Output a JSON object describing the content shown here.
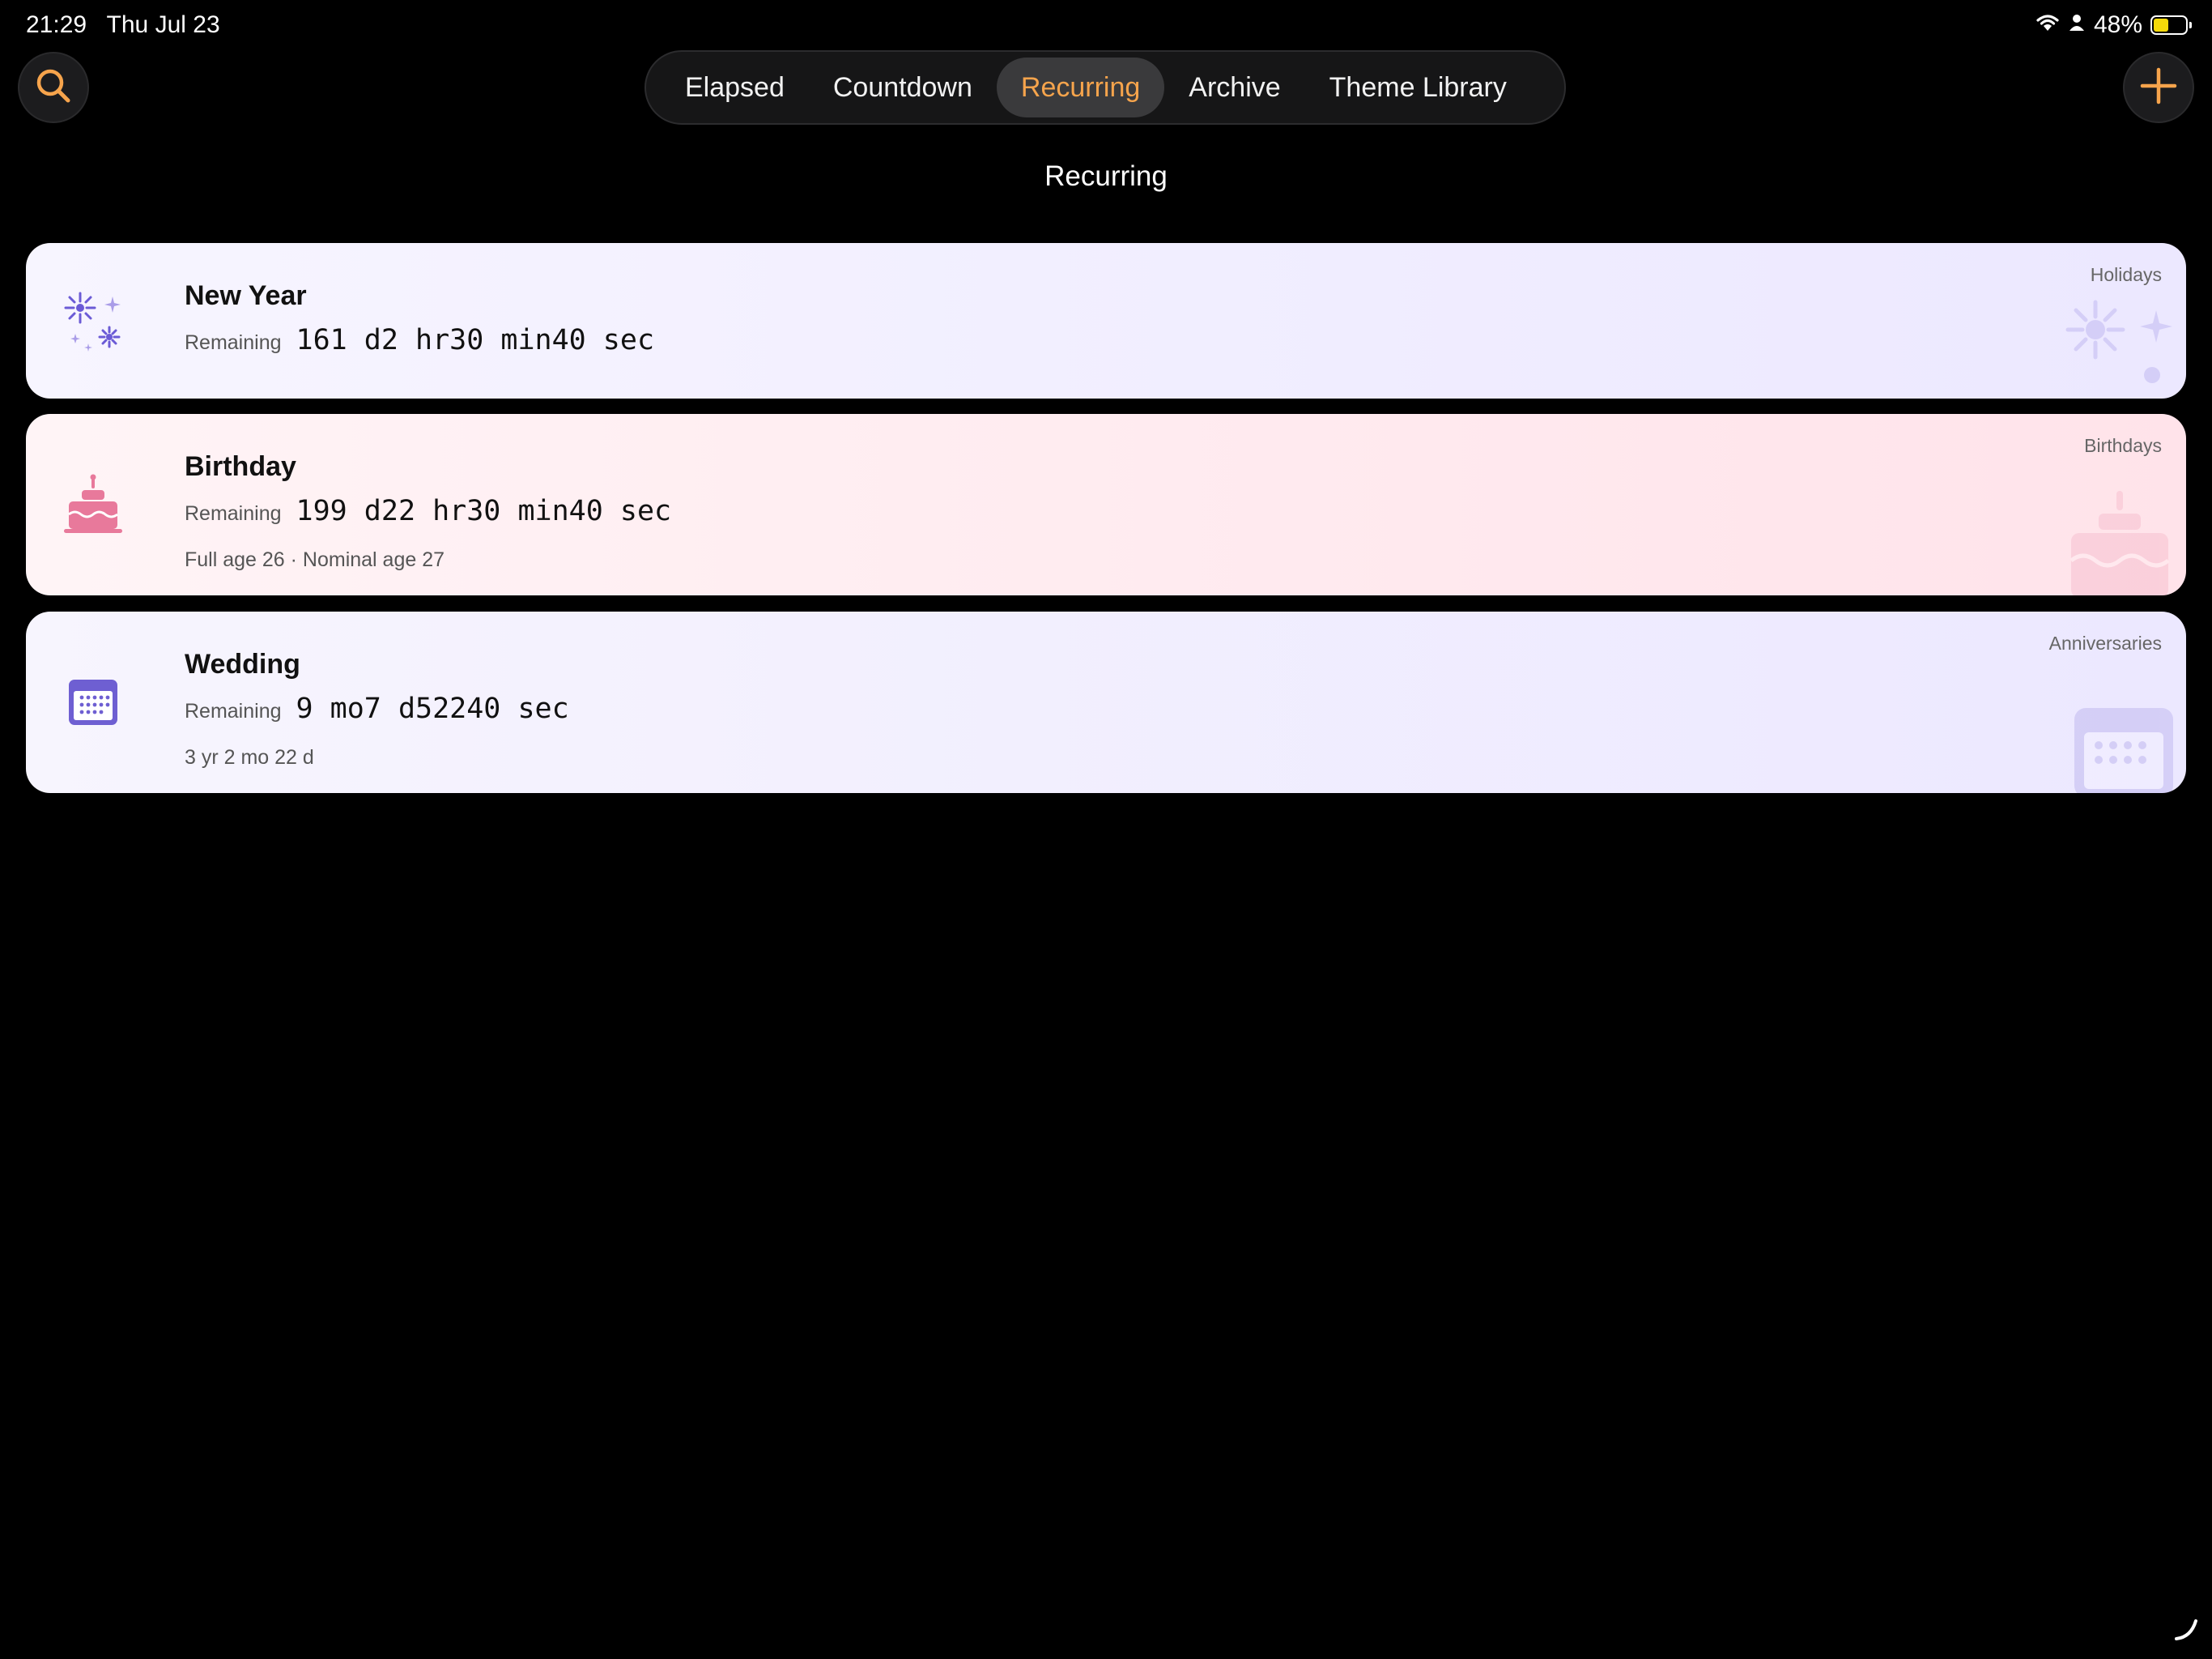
{
  "status_bar": {
    "time": "21:29",
    "date": "Thu Jul 23",
    "battery": "48%",
    "battery_level": 0.48
  },
  "toolbar": {
    "search_icon": "search-icon",
    "add_icon": "plus-icon",
    "accent_color": "#f6a44c"
  },
  "tabs": [
    {
      "label": "Elapsed",
      "active": false
    },
    {
      "label": "Countdown",
      "active": false
    },
    {
      "label": "Recurring",
      "active": true
    },
    {
      "label": "Archive",
      "active": false
    },
    {
      "label": "Theme Library",
      "active": false
    }
  ],
  "section_title": "Recurring",
  "cards": [
    {
      "name": "New Year",
      "remaining_label": "Remaining",
      "remaining": "161 d2 hr30 min40 sec",
      "subtitle": "",
      "category": "Holidays",
      "icon": "fireworks-icon",
      "color": "#6b5bd6"
    },
    {
      "name": "Birthday",
      "remaining_label": "Remaining",
      "remaining": "199 d22 hr30 min40 sec",
      "subtitle": "Full age 26 · Nominal age 27",
      "category": "Birthdays",
      "icon": "cake-icon",
      "color": "#e8799b"
    },
    {
      "name": "Wedding",
      "remaining_label": "Remaining",
      "remaining": "9 mo7 d52240 sec",
      "subtitle": "3 yr 2 mo 22 d",
      "category": "Anniversaries",
      "icon": "calendar-icon",
      "color": "#6e5fd2"
    }
  ]
}
